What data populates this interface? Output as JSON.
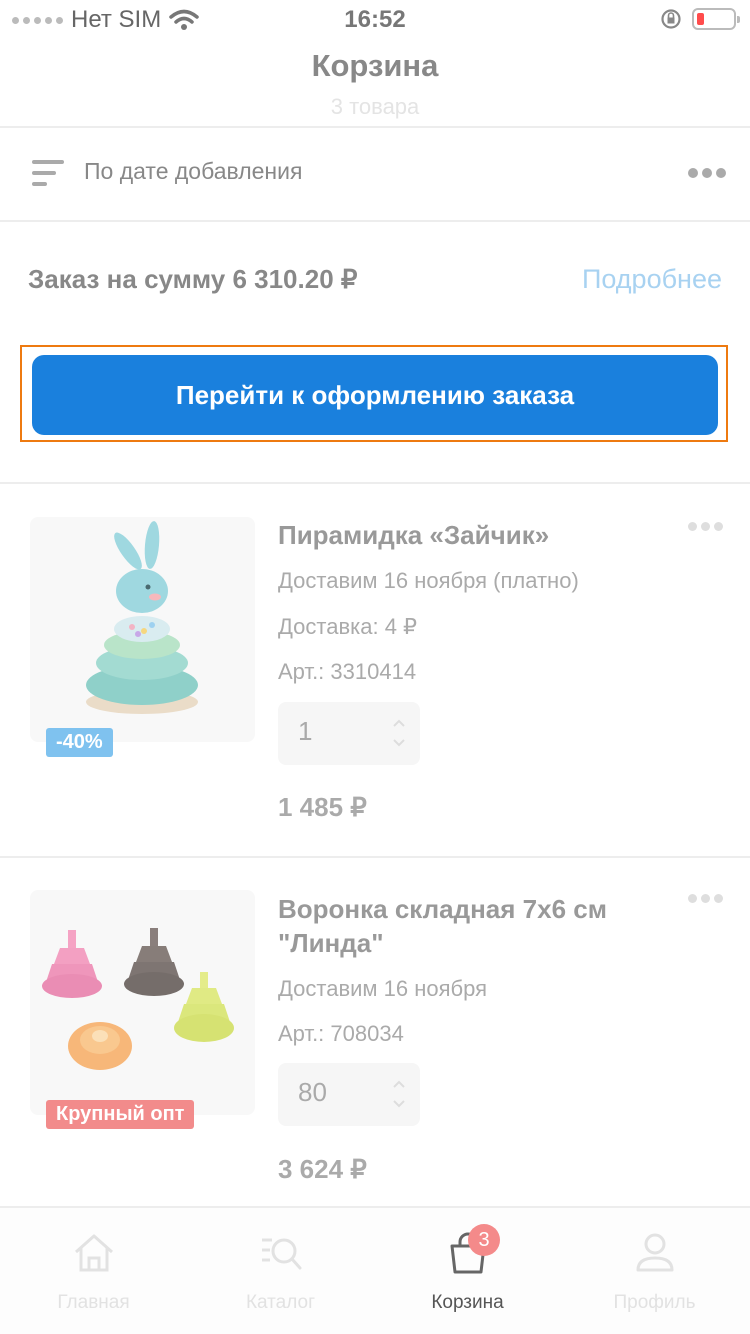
{
  "status_bar": {
    "carrier": "Нет SIM",
    "time": "16:52"
  },
  "header": {
    "title": "Корзина",
    "subtitle": "3 товара"
  },
  "sort": {
    "label": "По дате добавления"
  },
  "order": {
    "summary": "Заказ на сумму 6 310.20 ₽",
    "details_link": "Подробнее",
    "checkout_button": "Перейти к оформлению заказа"
  },
  "items": [
    {
      "title": "Пирамидка «Зайчик»",
      "delivery": "Доставим 16 ноября (платно)",
      "delivery_cost": "Доставка: 4 ₽",
      "article": "Арт.: 3310414",
      "quantity": "1",
      "price": "1 485 ₽",
      "badge": "-40%",
      "badge_color": "#7fc2ef"
    },
    {
      "title": "Воронка складная 7х6 см \"Линда\"",
      "delivery": "Доставим 16 ноября",
      "article": "Арт.: 708034",
      "quantity": "80",
      "price": "3 624 ₽",
      "badge": "Крупный опт",
      "badge_color": "#f28b8b"
    }
  ],
  "tabbar": {
    "tabs": [
      {
        "label": "Главная",
        "icon": "home-icon"
      },
      {
        "label": "Каталог",
        "icon": "catalog-search-icon"
      },
      {
        "label": "Корзина",
        "icon": "cart-bag-icon",
        "badge": "3",
        "active": true
      },
      {
        "label": "Профиль",
        "icon": "profile-icon"
      }
    ]
  },
  "colors": {
    "accent": "#1a80dd",
    "link": "#a8d2f1",
    "highlight": "#ee7a10"
  }
}
